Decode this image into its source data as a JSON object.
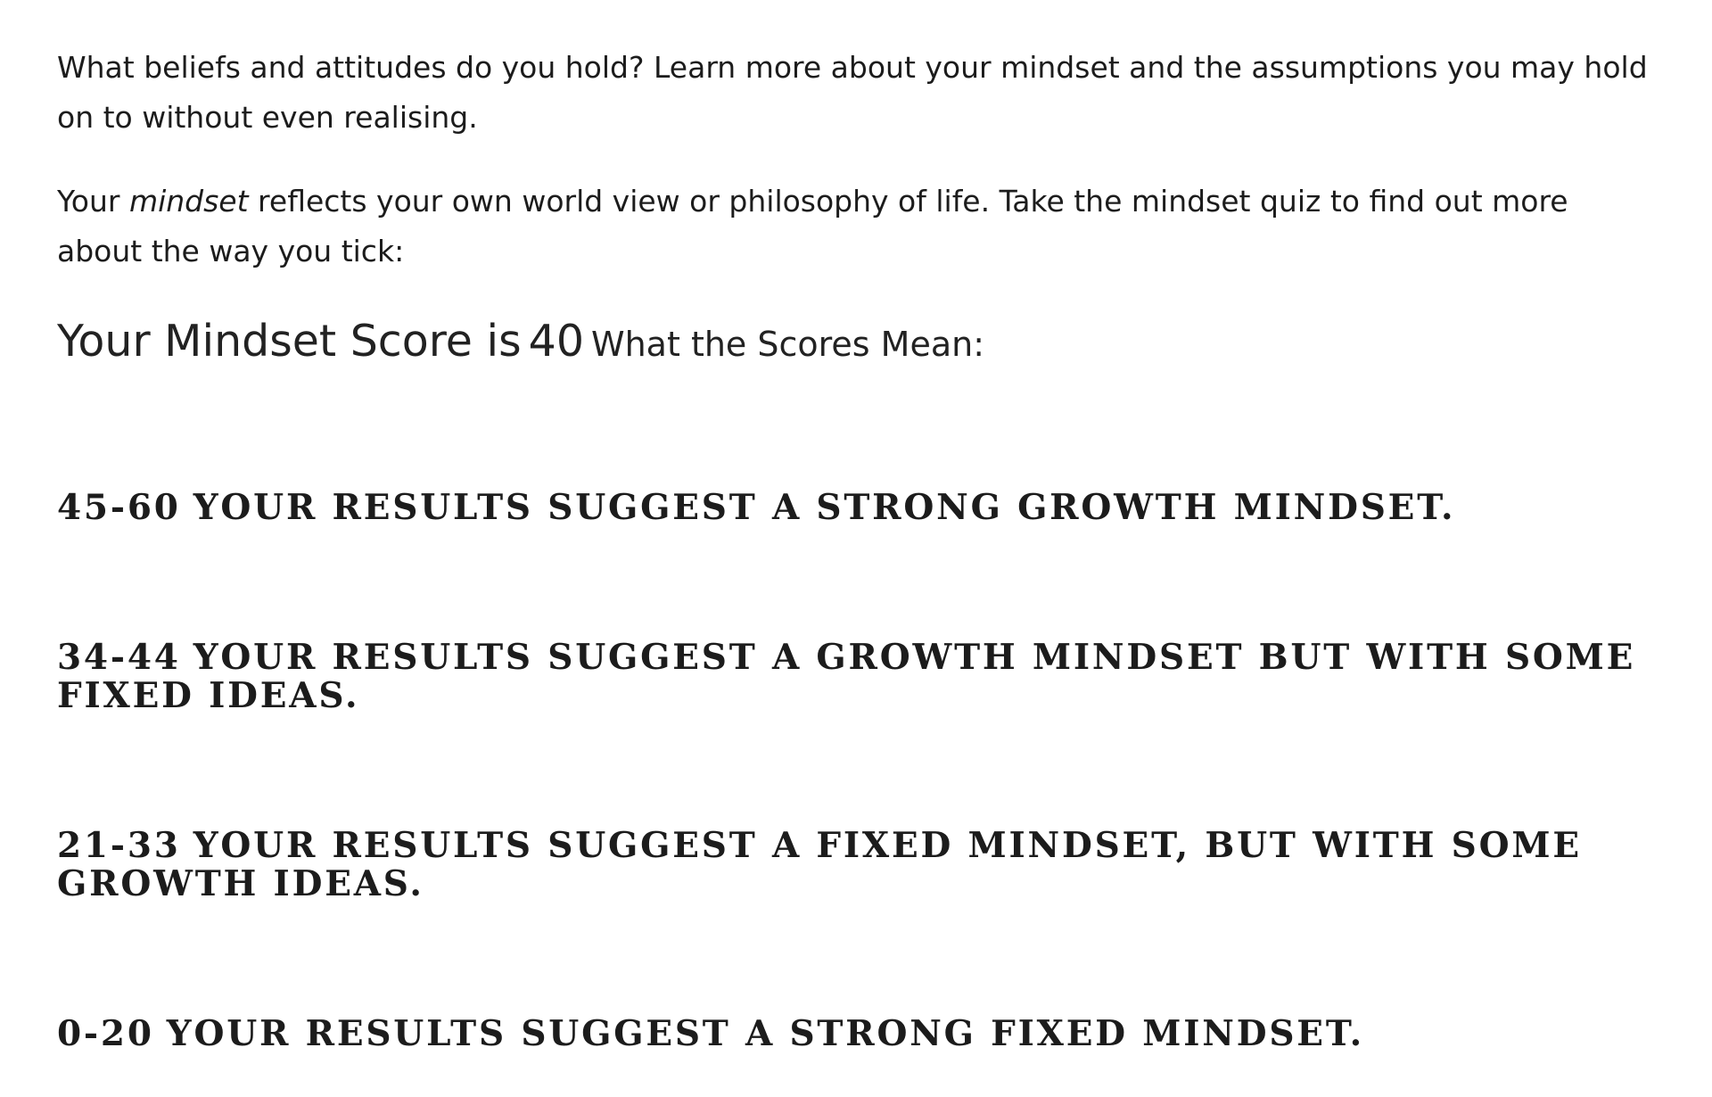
{
  "intro": {
    "paragraph1": "What beliefs and attitudes do you hold? Learn more about your mindset and the assumptions you may hold on to without even realising.",
    "paragraph2_prefix": "Your ",
    "paragraph2_emphasis": "mindset",
    "paragraph2_suffix": " reflects your own world view or philosophy of life. Take the mindset quiz to find out more about the way you tick:"
  },
  "score": {
    "label": "Your Mindset Score is",
    "value": "40",
    "meaning_heading": "What the Scores Mean:"
  },
  "ranges": [
    {
      "range": "45-60",
      "text": "YOUR RESULTS SUGGEST A STRONG GROWTH MINDSET."
    },
    {
      "range": "34-44",
      "text": "YOUR RESULTS SUGGEST A GROWTH MINDSET BUT WITH SOME FIXED IDEAS."
    },
    {
      "range": "21-33",
      "text": "YOUR RESULTS SUGGEST A FIXED MINDSET, BUT WITH SOME GROWTH IDEAS."
    },
    {
      "range": "0-20",
      "text": "YOUR RESULTS SUGGEST A STRONG FIXED MINDSET."
    }
  ]
}
